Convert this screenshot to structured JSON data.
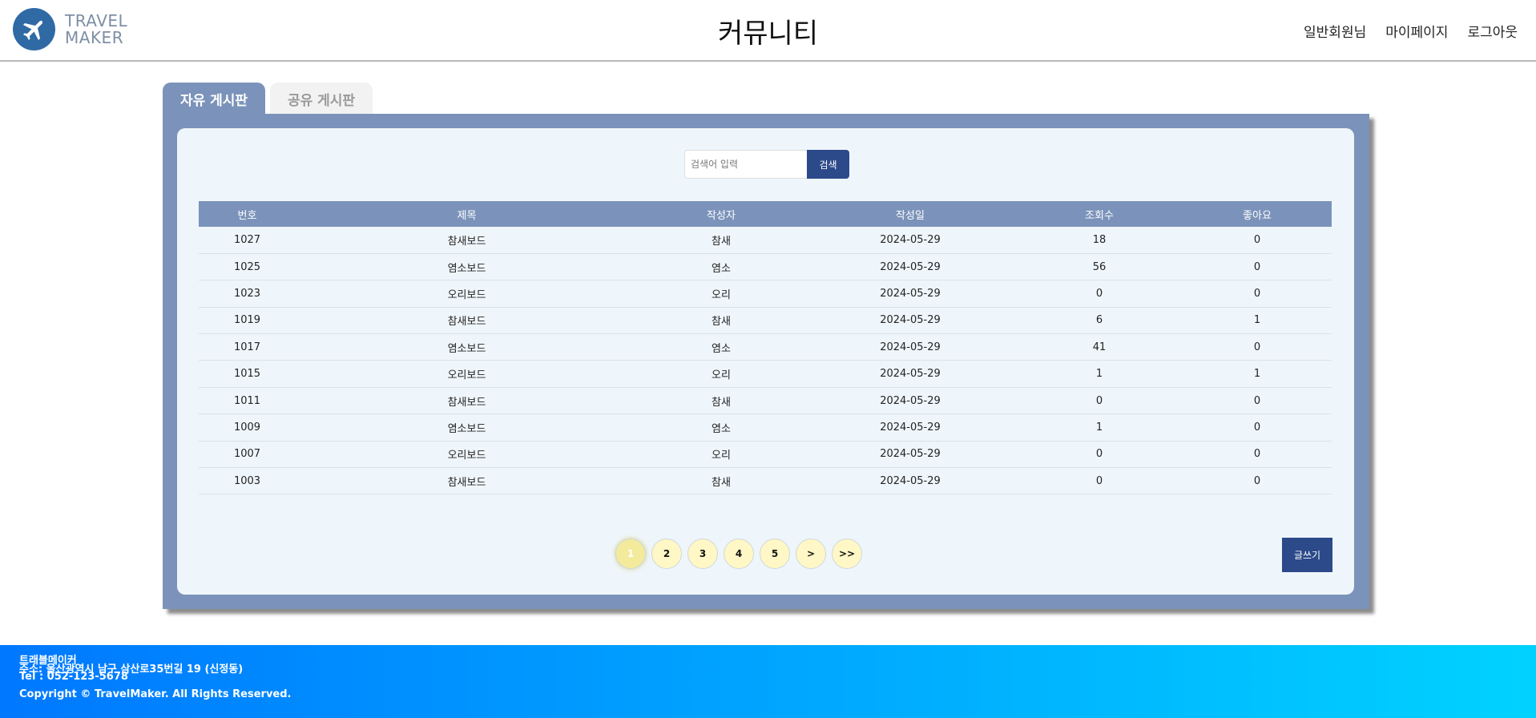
{
  "header": {
    "logo_line1": "TRAVEL",
    "logo_line2": "MAKER",
    "title": "커뮤니티",
    "nav": [
      "일반회원님",
      "마이페이지",
      "로그아웃"
    ]
  },
  "tabs": [
    "자유 게시판",
    "공유 게시판"
  ],
  "search": {
    "placeholder": "검색어 입력",
    "button": "검색"
  },
  "table": {
    "columns": [
      "번호",
      "제목",
      "작성자",
      "작성일",
      "조회수",
      "좋아요"
    ],
    "rows": [
      [
        "1027",
        "참새보드",
        "참새",
        "2024-05-29",
        "18",
        "0"
      ],
      [
        "1025",
        "염소보드",
        "염소",
        "2024-05-29",
        "56",
        "0"
      ],
      [
        "1023",
        "오리보드",
        "오리",
        "2024-05-29",
        "0",
        "0"
      ],
      [
        "1019",
        "참새보드",
        "참새",
        "2024-05-29",
        "6",
        "1"
      ],
      [
        "1017",
        "염소보드",
        "염소",
        "2024-05-29",
        "41",
        "0"
      ],
      [
        "1015",
        "오리보드",
        "오리",
        "2024-05-29",
        "1",
        "1"
      ],
      [
        "1011",
        "참새보드",
        "참새",
        "2024-05-29",
        "0",
        "0"
      ],
      [
        "1009",
        "염소보드",
        "염소",
        "2024-05-29",
        "1",
        "0"
      ],
      [
        "1007",
        "오리보드",
        "오리",
        "2024-05-29",
        "0",
        "0"
      ],
      [
        "1003",
        "참새보드",
        "참새",
        "2024-05-29",
        "0",
        "0"
      ]
    ]
  },
  "pagination": {
    "pages": [
      "1",
      "2",
      "3",
      "4",
      "5",
      ">",
      ">>"
    ],
    "current": "1"
  },
  "write_button": "글쓰기",
  "footer": {
    "name": "트래블메이커",
    "address": "주소: 울산광역시 남구 삼산로35번길 19 (신정동)",
    "tel": "Tel : 052-123-5678",
    "copyright": "Copyright © TravelMaker. All Rights Reserved."
  },
  "colors": {
    "board": "#7b93ba",
    "primary_button": "#2c4a8a",
    "page_button": "#fff7c5",
    "footer_start": "#0078ff",
    "footer_end": "#00d2ff"
  },
  "icons": {
    "logo": "airplane-icon"
  }
}
